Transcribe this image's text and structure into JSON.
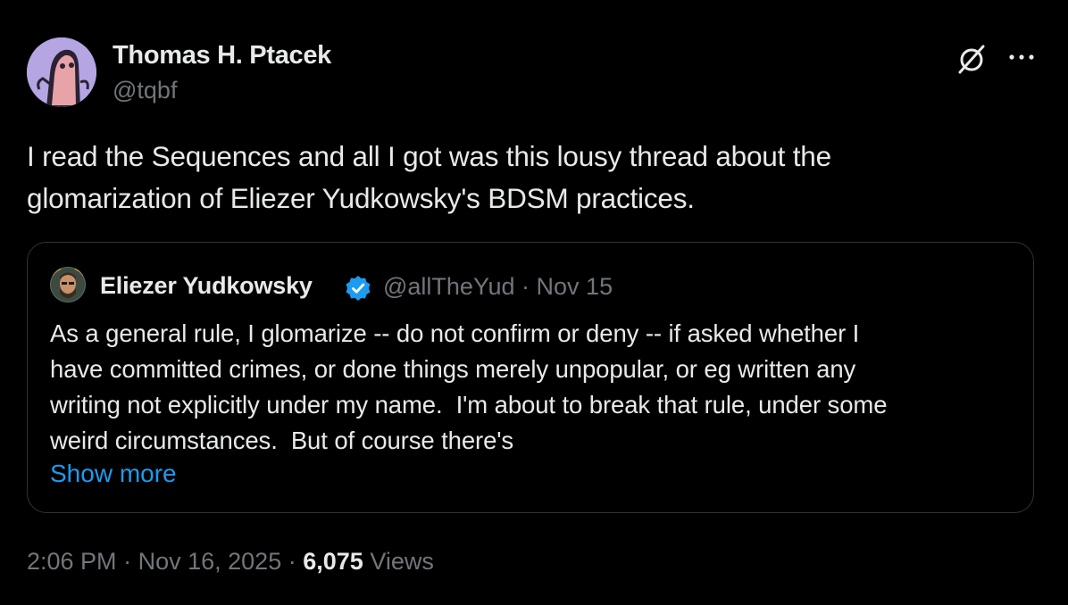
{
  "author": {
    "name": "Thomas H. Ptacek",
    "handle": "@tqbf"
  },
  "tweet": {
    "text_lines": [
      "I read the Sequences and all I got was this lousy thread about the",
      "glomarization of Eliezer Yudkowsky's BDSM practices."
    ]
  },
  "quote": {
    "name": "Eliezer Yudkowsky",
    "handle": "@allTheYud",
    "separator": "·",
    "date": "Nov 15",
    "text_lines": [
      "As a general rule, I glomarize -- do not confirm or deny -- if asked whether I",
      "have committed crimes, or done things merely unpopular, or eg written any",
      "writing not explicitly under my name.  I'm about to break that rule, under some",
      "weird circumstances.  But of course there's"
    ],
    "show_more": "Show more"
  },
  "footer": {
    "time": "2:06 PM",
    "date": "Nov 16, 2025",
    "separator": "·",
    "views_count": "6,075",
    "views_label": "Views"
  },
  "icons": {
    "grok": "grok-icon",
    "more": "more-icon",
    "verified": "verified-badge-icon"
  },
  "colors": {
    "background": "#000000",
    "text": "#e7e9ea",
    "secondary": "#71767b",
    "link": "#1d9bf0",
    "border": "#2f3336",
    "verified": "#1d9bf0"
  }
}
